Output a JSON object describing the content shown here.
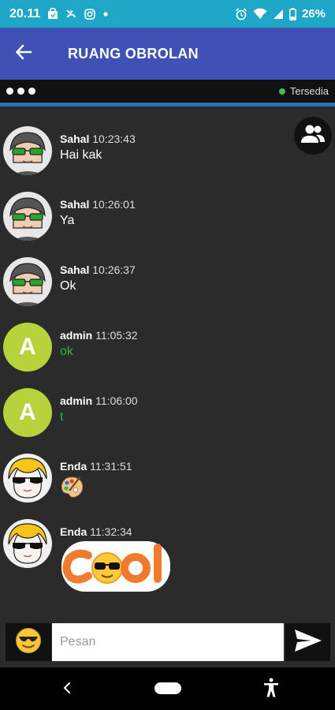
{
  "status_bar": {
    "time": "20.11",
    "battery": "26%",
    "icons": [
      "bag-icon",
      "missed-call-icon",
      "instagram-icon",
      "dot-icon",
      "alarm-icon",
      "wifi-icon",
      "signal-icon",
      "battery-icon"
    ]
  },
  "app_bar": {
    "title": "RUANG OBROLAN",
    "back_icon": "arrow-left-icon",
    "color": "#3f51b5"
  },
  "presence": {
    "status_text": "Tersedia",
    "status_color": "#3fbe4c"
  },
  "messages": [
    {
      "sender": "Sahal",
      "time": "10:23:43",
      "text": "Hai kak",
      "avatar": "sunglasses-boy"
    },
    {
      "sender": "Sahal",
      "time": "10:26:01",
      "text": "Ya",
      "avatar": "sunglasses-boy"
    },
    {
      "sender": "Sahal",
      "time": "10:26:37",
      "text": "Ok",
      "avatar": "sunglasses-boy"
    },
    {
      "sender": "admin",
      "time": "11:05:32",
      "text": "ok",
      "avatar_letter": "A",
      "text_color": "#36b23f"
    },
    {
      "sender": "admin",
      "time": "11:06:00",
      "text": "t",
      "avatar_letter": "A",
      "text_color": "#36b23f"
    },
    {
      "sender": "Enda",
      "time": "11:31:51",
      "sticker": "palette-emoji",
      "avatar": "blonde-sunglasses"
    },
    {
      "sender": "Enda",
      "time": "11:32:34",
      "sticker": "cool-sticker",
      "sticker_text": "COOL",
      "avatar": "blonde-sunglasses"
    }
  ],
  "composer": {
    "placeholder": "Pesan",
    "emoji_icon": "smiley-sunglasses-icon",
    "send_icon": "send-icon"
  },
  "nav_bar": {
    "icons": [
      "back-chevron-icon",
      "home-pill-icon",
      "accessibility-icon"
    ]
  }
}
